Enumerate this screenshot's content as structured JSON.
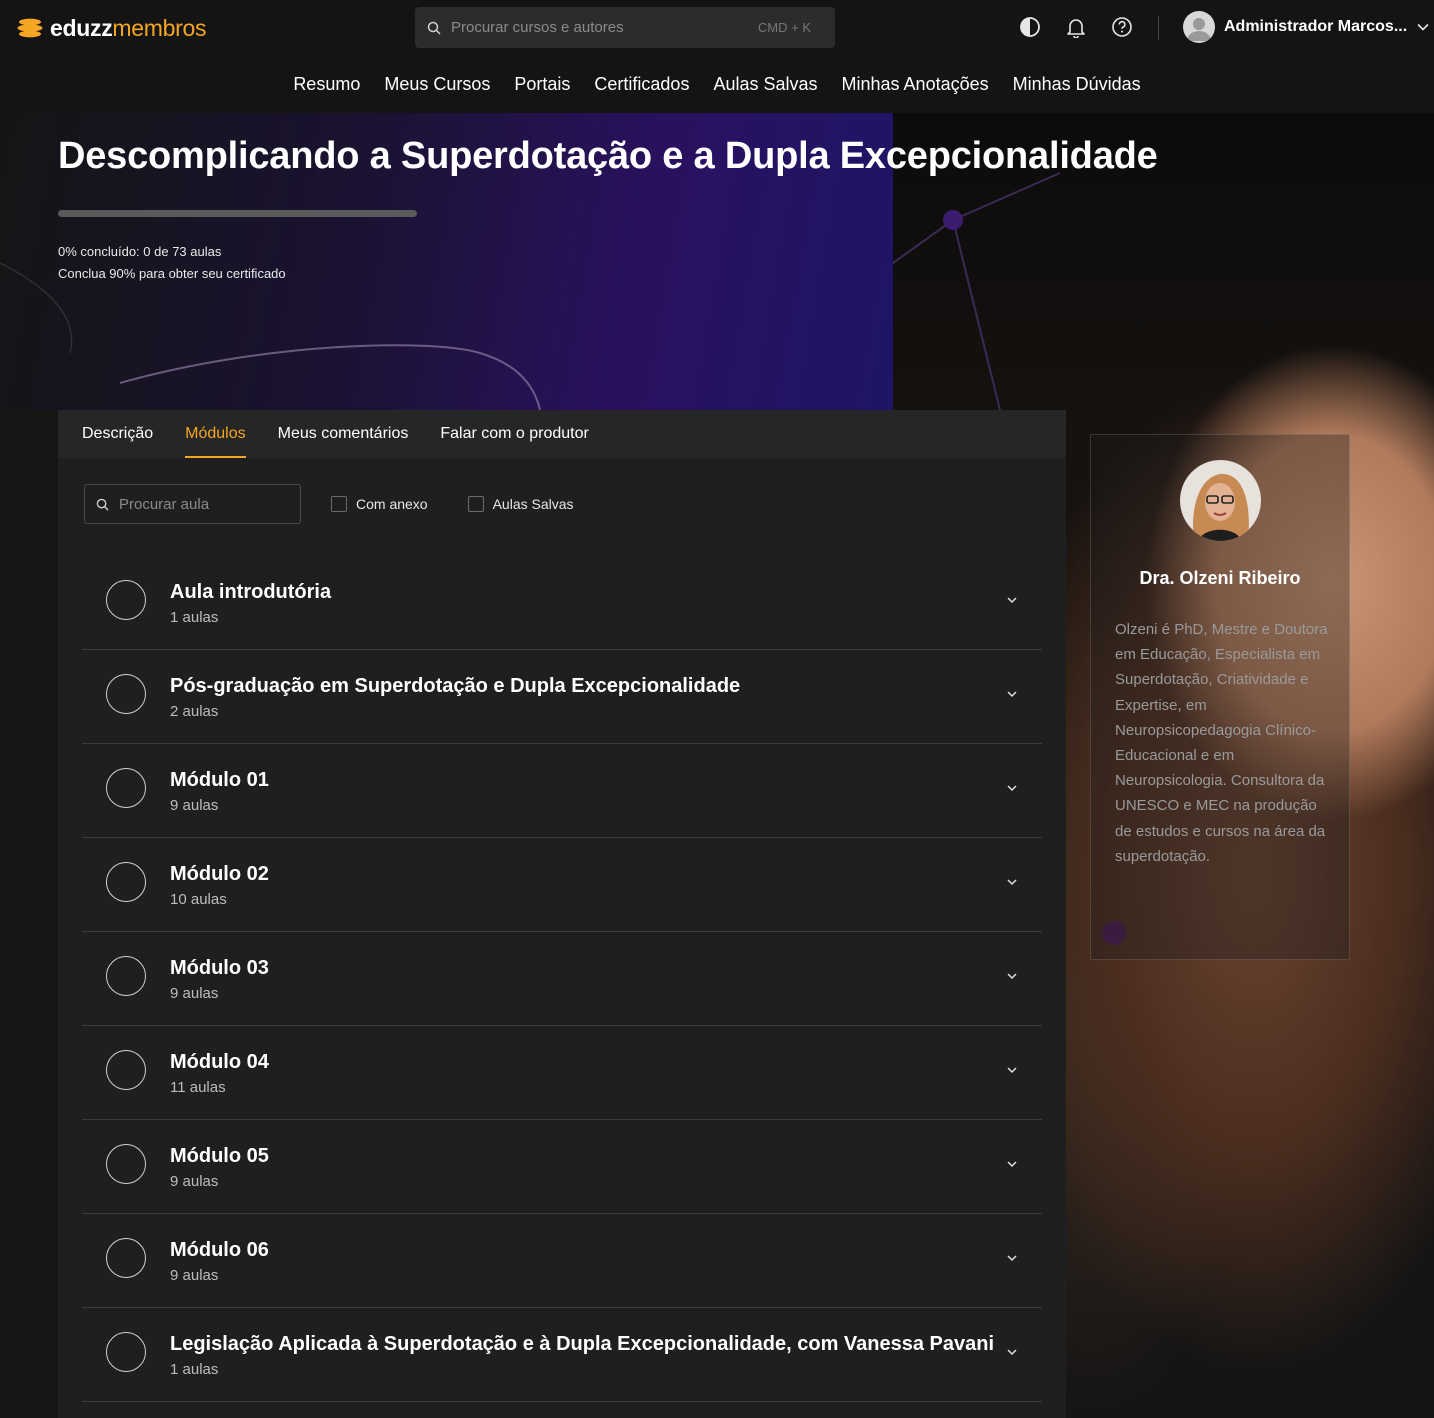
{
  "brand": {
    "name_a": "eduzz",
    "name_b": "membros"
  },
  "search": {
    "placeholder": "Procurar cursos e autores",
    "shortcut": "CMD + K"
  },
  "header_icons": [
    "contrast-icon",
    "bell-icon",
    "help-icon"
  ],
  "user": {
    "name": "Administrador Marcos..."
  },
  "nav": [
    {
      "label": "Resumo"
    },
    {
      "label": "Meus Cursos"
    },
    {
      "label": "Portais"
    },
    {
      "label": "Certificados"
    },
    {
      "label": "Aulas Salvas"
    },
    {
      "label": "Minhas Anotações"
    },
    {
      "label": "Minhas Dúvidas"
    }
  ],
  "course": {
    "title": "Descomplicando a Superdotação e a Dupla Excepcionalidade",
    "progress_fraction": 0,
    "progress_text": "0% concluído: 0 de 73 aulas",
    "certificate_text": "Conclua 90% para obter seu certificado"
  },
  "tabs": [
    {
      "label": "Descrição",
      "active": false
    },
    {
      "label": "Módulos",
      "active": true
    },
    {
      "label": "Meus comentários",
      "active": false
    },
    {
      "label": "Falar com o produtor",
      "active": false
    }
  ],
  "filters": {
    "search_placeholder": "Procurar aula",
    "with_attachment": "Com anexo",
    "saved_lessons": "Aulas Salvas"
  },
  "modules": [
    {
      "title": "Aula introdutória",
      "count": "1 aulas"
    },
    {
      "title": "Pós-graduação em Superdotação e Dupla Excepcionalidade",
      "count": "2 aulas"
    },
    {
      "title": "Módulo 01",
      "count": "9 aulas"
    },
    {
      "title": "Módulo 02",
      "count": "10 aulas"
    },
    {
      "title": "Módulo 03",
      "count": "9 aulas"
    },
    {
      "title": "Módulo 04",
      "count": "11 aulas"
    },
    {
      "title": "Módulo 05",
      "count": "9 aulas"
    },
    {
      "title": "Módulo 06",
      "count": "9 aulas"
    },
    {
      "title": "Legislação Aplicada à Superdotação e à Dupla Excepcionalidade, com Vanessa Pavani",
      "count": "1 aulas"
    }
  ],
  "producer": {
    "name": "Dra. Olzeni Ribeiro",
    "bio": "Olzeni é PhD, Mestre e Doutora em Educação, Especialista em Superdotação, Criatividade e Expertise, em Neuropsicopedagogia Clínico-Educacional e em Neuropsicologia. Consultora da UNESCO e MEC na produção de estudos e cursos na área da superdotação."
  },
  "colors": {
    "accent": "#f5a623",
    "background": "#141414",
    "panel": "#1f1f1f"
  }
}
